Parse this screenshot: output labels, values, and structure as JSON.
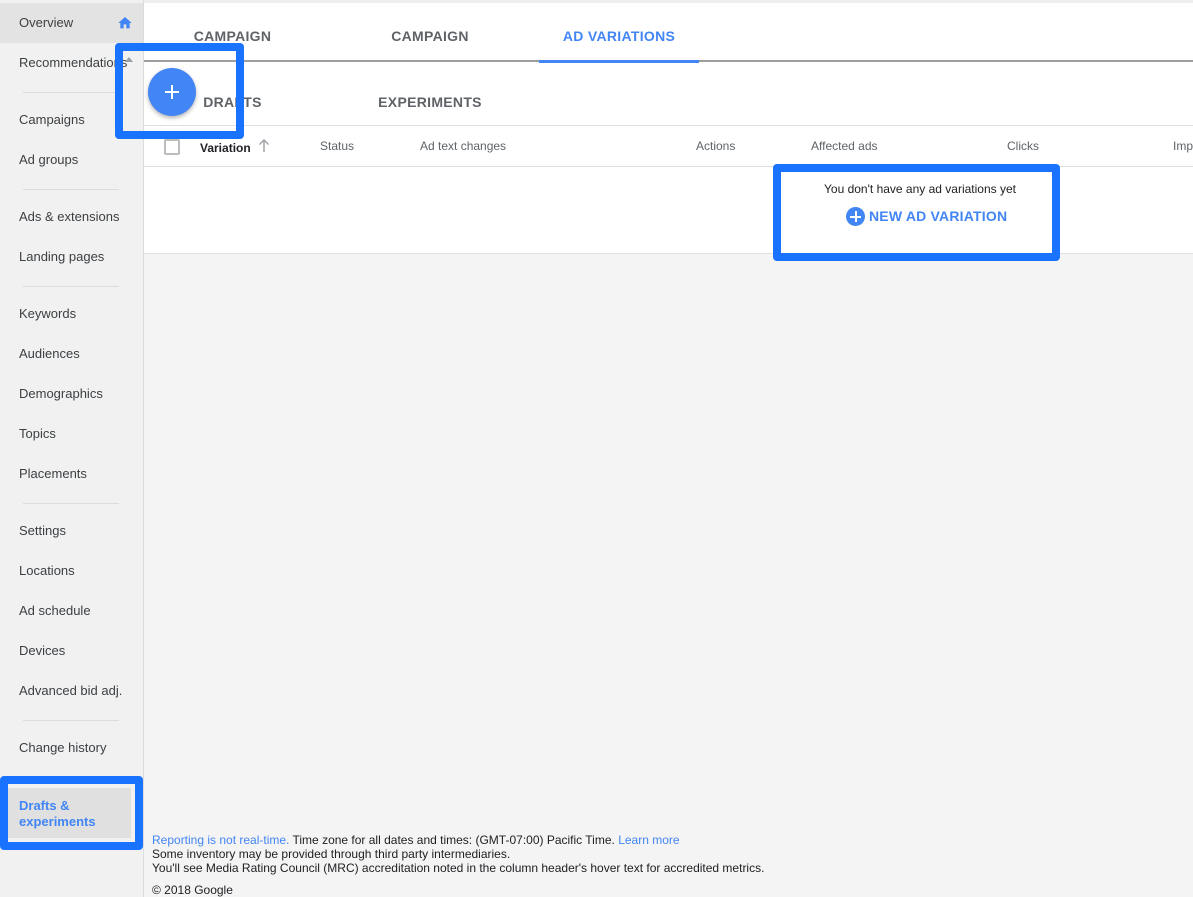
{
  "sidebar": {
    "items": [
      {
        "label": "Overview"
      },
      {
        "label": "Recommendations"
      },
      {
        "label": "Campaigns"
      },
      {
        "label": "Ad groups"
      },
      {
        "label": "Ads & extensions"
      },
      {
        "label": "Landing pages"
      },
      {
        "label": "Keywords"
      },
      {
        "label": "Audiences"
      },
      {
        "label": "Demographics"
      },
      {
        "label": "Topics"
      },
      {
        "label": "Placements"
      },
      {
        "label": "Settings"
      },
      {
        "label": "Locations"
      },
      {
        "label": "Ad schedule"
      },
      {
        "label": "Devices"
      },
      {
        "label": "Advanced bid adj."
      },
      {
        "label": "Change history"
      }
    ],
    "active": {
      "label": "Drafts & experiments"
    }
  },
  "tabs": [
    {
      "label": "CAMPAIGN DRAFTS"
    },
    {
      "label": "CAMPAIGN EXPERIMENTS"
    },
    {
      "label": "AD VARIATIONS"
    }
  ],
  "table": {
    "columns": [
      "Variation",
      "Status",
      "Ad text changes",
      "Actions",
      "Affected ads",
      "Clicks",
      "Imp"
    ]
  },
  "empty_state": {
    "message": "You don't have any ad variations yet",
    "button_label": "NEW AD VARIATION"
  },
  "footer": {
    "realtime_link": "Reporting is not real-time.",
    "timezone_text": " Time zone for all dates and times: (GMT-07:00) Pacific Time. ",
    "learn_more": "Learn more",
    "inventory_text": "Some inventory may be provided through third party intermediaries.",
    "mrc_text": "You'll see Media Rating Council (MRC) accreditation noted in the column header's hover text for accredited metrics.",
    "copyright": "© 2018 Google"
  },
  "colors": {
    "accent": "#4285f4",
    "highlight": "#1a73ff"
  }
}
